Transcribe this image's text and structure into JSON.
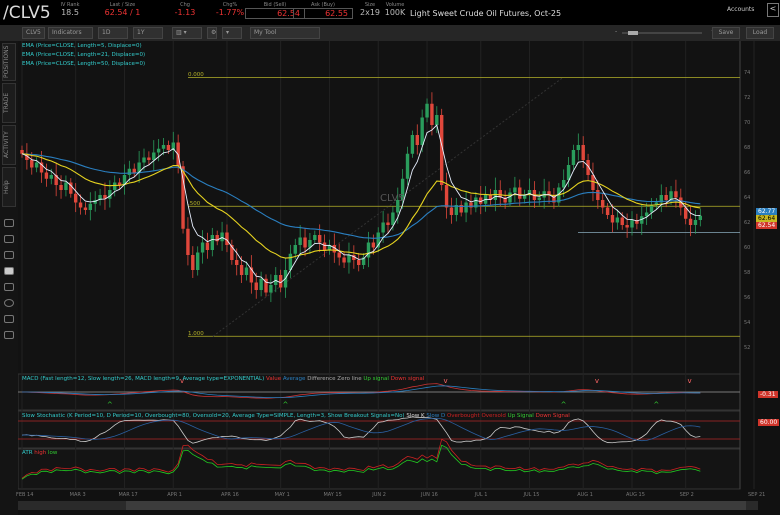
{
  "header": {
    "symbol": "/CLV5",
    "iv_rank_label": "IV Rank",
    "iv_rank": "18.5",
    "last_label": "Last / Size",
    "last": "62.54 / 1",
    "chg_label": "Chg",
    "chg": "-1.13",
    "chgp_label": "Chg%",
    "chgp": "-1.77%",
    "bid_label": "Bid (Sell)",
    "bid": "62.54",
    "ask_label": "Ask (Buy)",
    "ask": "62.55",
    "size_label": "Size",
    "size": "2x19",
    "volume_label": "Volume",
    "volume": "100K",
    "description": "Light Sweet Crude Oil Futures, Oct-25",
    "accounts": "Accounts",
    "back": "<"
  },
  "toolbar": {
    "symbol": "CLV5",
    "studies": "Indicators",
    "period": "1D",
    "range": "1Y",
    "tool": "My Tool",
    "save": "Save",
    "load": "Load"
  },
  "side_tabs": [
    "POSITIONS",
    "TRADE",
    "ACTIVITY",
    "Help"
  ],
  "legends": {
    "ema5": "EMA (Price=CLOSE, Length=5, Displace=0)",
    "ema21": "EMA (Price=CLOSE, Length=21, Displace=0)",
    "ema50": "EMA (Price=CLOSE, Length=50, Displace=0)",
    "macd": "MACD (Fast length=12, Slow length=26, MACD length=9, Average type=EXPONENTIAL)",
    "macd_items": [
      "Value",
      "Average",
      "Difference",
      "Zero line",
      "Up signal",
      "Down signal"
    ],
    "stoch": "Slow Stochastic (K Period=10, D Period=10, Overbought=80, Oversold=20, Average Type=SIMPLE, Length=3, Show Breakout Signals=No)",
    "stoch_items": [
      "Slow K",
      "Slow D",
      "Overbought",
      "Oversold",
      "Up Signal",
      "Down Signal"
    ],
    "atr": "ATR",
    "atr_items": [
      "high",
      "low"
    ]
  },
  "fib": {
    "top": "0.000",
    "mid": ".500",
    "bottom": "1.000"
  },
  "watermark": "CLV5",
  "right_labels": {
    "ema5": "62.77",
    "ema21": "62.64",
    "price": "62.54",
    "macd": "-0.31",
    "stoch": "60.00"
  },
  "chart_data": {
    "type": "candlestick",
    "ylim": [
      50.2,
      75.0
    ],
    "price_ticks": [
      74,
      72,
      70,
      68,
      66,
      64,
      62,
      60,
      58,
      56,
      54,
      52
    ],
    "date_labels": [
      "FEB 14",
      "MAR 3",
      "MAR 17",
      "APR 1",
      "APR 16",
      "MAY 1",
      "MAY 15",
      "JUN 2",
      "JUN 16",
      "JUL 1",
      "JUL 15",
      "AUG 1",
      "AUG 15",
      "SEP 2",
      "SEP 21"
    ],
    "date_label_index": [
      0,
      11,
      21,
      31,
      42,
      53,
      63,
      73,
      83,
      94,
      104,
      115,
      125,
      136,
      150
    ],
    "close": [
      67.5,
      67.0,
      66.4,
      66.8,
      66.0,
      65.5,
      65.8,
      65.0,
      64.6,
      65.2,
      64.3,
      63.6,
      63.2,
      63.0,
      63.5,
      63.8,
      64.2,
      63.9,
      64.6,
      65.2,
      65.0,
      65.8,
      66.3,
      66.0,
      66.8,
      67.2,
      67.0,
      67.6,
      67.9,
      68.2,
      67.8,
      68.4,
      66.5,
      61.5,
      59.4,
      58.2,
      59.6,
      60.4,
      59.8,
      61.0,
      60.5,
      61.2,
      60.2,
      59.0,
      58.6,
      57.8,
      58.4,
      57.2,
      56.6,
      57.5,
      56.4,
      57.0,
      57.8,
      56.8,
      58.2,
      59.5,
      60.2,
      60.8,
      60.0,
      60.6,
      61.0,
      60.4,
      59.8,
      60.2,
      59.6,
      59.2,
      58.8,
      59.4,
      59.0,
      58.6,
      59.2,
      60.4,
      60.0,
      61.2,
      62.0,
      61.8,
      62.8,
      63.8,
      65.5,
      67.5,
      69.0,
      68.2,
      70.4,
      71.5,
      69.8,
      70.6,
      65.0,
      63.2,
      62.6,
      63.4,
      62.8,
      63.6,
      63.2,
      64.0,
      63.5,
      64.2,
      63.8,
      64.6,
      64.0,
      63.6,
      64.4,
      64.8,
      63.9,
      64.2,
      64.6,
      63.8,
      64.0,
      64.5,
      64.2,
      63.6,
      64.8,
      65.4,
      66.6,
      67.8,
      68.2,
      67.0,
      65.8,
      64.6,
      63.8,
      63.2,
      62.6,
      62.0,
      62.4,
      61.8,
      61.6,
      62.2,
      61.9,
      62.5,
      62.8,
      63.4,
      63.6,
      64.2,
      63.8,
      64.5,
      64.0,
      63.2,
      62.3,
      61.8,
      62.2,
      62.54
    ],
    "fib_levels": {
      "0.000": 73.6,
      "0.500": 63.3,
      "1.000": 52.9
    },
    "support_level": 61.2,
    "colors": {
      "up": "#2a9d5c",
      "down": "#e0473b",
      "ema5": "#e8f0ff",
      "ema21": "#e6d320",
      "ema50": "#2a7fc0",
      "fib": "#b5b22a"
    }
  }
}
